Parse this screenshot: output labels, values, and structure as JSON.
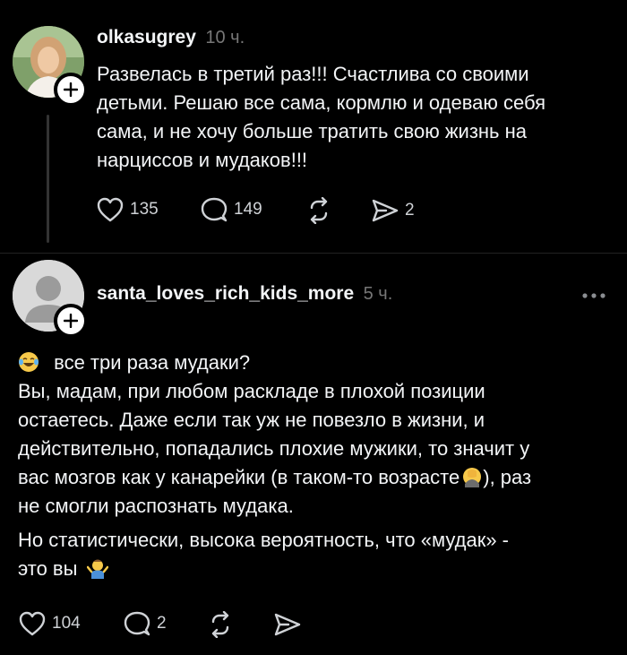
{
  "post": {
    "username": "olkasugrey",
    "time": "10 ч.",
    "lines": [
      "Развелась в третий раз!!! Счастлива со своими",
      "детьми. Решаю все сама, кормлю и одеваю себя",
      "сама, и не хочу больше тратить свою жизнь на",
      "нарциссов и мудаков!!!"
    ],
    "likes": "135",
    "comments": "149",
    "shares": "2"
  },
  "reply": {
    "username": "santa_loves_rich_kids_more",
    "time": "5 ч.",
    "line1": "все три раза мудаки?",
    "line2": "Вы, мадам, при любом раскладе в плохой позиции",
    "line3": "остаетесь. Даже если так уж не повезло в жизни, и",
    "line4": "действительно, попадались плохие мужики, то значит у",
    "line5a": "вас мозгов как у канарейки (в таком-то возрасте",
    "line5b": "), раз",
    "line6": "не смогли распознать мудака.",
    "line7": "Но статистически, высока вероятность, что «мудак» -",
    "line8": "это вы",
    "likes": "104",
    "comments": "2"
  },
  "icons": {
    "heart": "heart-icon",
    "comment": "comment-icon",
    "repost": "repost-icon",
    "share": "share-icon",
    "more": "more-icon",
    "plus": "plus-icon"
  }
}
